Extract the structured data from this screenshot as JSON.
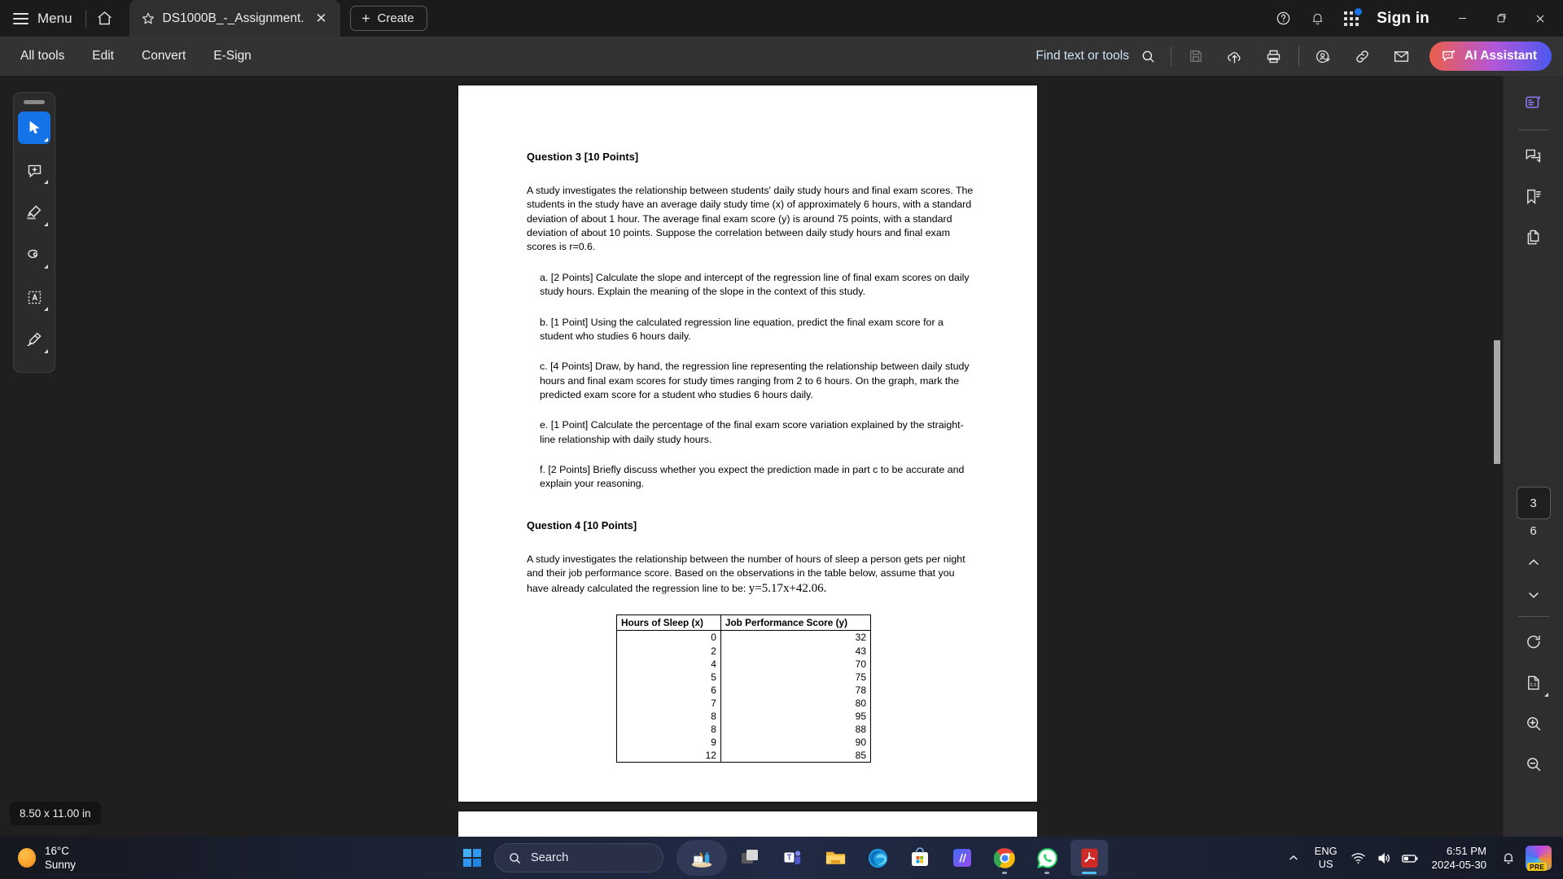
{
  "titlebar": {
    "menu_label": "Menu",
    "home_icon": "home-icon",
    "tab": {
      "star_icon": "star-icon",
      "title": "DS1000B_-_Assignment...",
      "close_icon": "close-icon"
    },
    "create_label": "Create",
    "help_icon": "help-circle-icon",
    "bell_icon": "bell-icon",
    "apps_icon": "apps-grid-icon",
    "signin_label": "Sign in",
    "minimize_icon": "minimize-icon",
    "maximize_icon": "maximize-icon",
    "close_icon": "window-close-icon"
  },
  "cmdbar": {
    "items": [
      {
        "label": "All tools",
        "name": "all-tools"
      },
      {
        "label": "Edit",
        "name": "edit"
      },
      {
        "label": "Convert",
        "name": "convert"
      },
      {
        "label": "E-Sign",
        "name": "esign"
      }
    ],
    "find_label": "Find text or tools",
    "icons": [
      "save-icon",
      "upload-cloud-icon",
      "print-icon",
      "add-person-icon",
      "link-icon",
      "email-icon"
    ],
    "ai_assistant_label": "AI Assistant",
    "ai_gradient_from": "#ec5f4a",
    "ai_gradient_to": "#4b58f0"
  },
  "left_toolbar": {
    "tools": [
      {
        "name": "select-tool",
        "icon": "cursor-icon",
        "active": true
      },
      {
        "name": "add-comment-tool",
        "icon": "comment-plus-icon",
        "active": false
      },
      {
        "name": "highlight-tool",
        "icon": "highlighter-icon",
        "active": false
      },
      {
        "name": "draw-oval-tool",
        "icon": "lasso-icon",
        "active": false
      },
      {
        "name": "text-select-tool",
        "icon": "text-box-icon",
        "active": false
      },
      {
        "name": "fill-sign-tool",
        "icon": "pen-sign-icon",
        "active": false
      }
    ]
  },
  "right_rail": {
    "tools": [
      {
        "name": "ai-summary",
        "icon": "ai-summary-icon",
        "accent": "#7a6ff0"
      },
      {
        "name": "comments",
        "icon": "comment-bubbles-icon"
      },
      {
        "name": "bookmarks",
        "icon": "bookmark-list-icon"
      },
      {
        "name": "page-thumbnails",
        "icon": "copy-pages-icon"
      }
    ],
    "current_page": "3",
    "total_pages": "6",
    "prev_icon": "chevron-up-icon",
    "next_icon": "chevron-down-icon",
    "rotate_icon": "rotate-icon",
    "fit_icon": "fit-page-icon",
    "zoom_in_icon": "zoom-in-icon",
    "zoom_out_icon": "zoom-out-icon"
  },
  "document": {
    "page_size_label": "8.50 x 11.00 in",
    "q3_title": "Question 3 [10 Points]",
    "q3_intro": "A study investigates the relationship between students' daily study hours and final exam scores. The students in the study have an average daily study time (x) of approximately 6 hours, with a standard deviation of about 1 hour. The average final exam score (y) is around 75 points, with a standard deviation of about 10 points. Suppose the correlation between daily study hours and final exam scores is r=0.6.",
    "q3_parts": [
      "a. [2 Points] Calculate the slope and intercept of the regression line of final exam scores on daily study hours. Explain the meaning of the slope in the context of this study.",
      "b. [1 Point] Using the calculated regression line equation, predict the final exam score for a student who studies 6 hours daily.",
      "c. [4 Points] Draw, by hand, the regression line representing the relationship between daily study hours and final exam scores for study times ranging from 2 to 6 hours. On the graph, mark the predicted exam score for a student who studies 6 hours daily.",
      "e. [1 Point] Calculate the percentage of the final exam score variation explained by the straight-line relationship with daily study hours.",
      "f. [2 Points] Briefly discuss whether you expect the prediction made in part c to be accurate and explain your reasoning."
    ],
    "q4_title": "Question 4 [10 Points]",
    "q4_intro_pre": "A study investigates the relationship between the number of hours of sleep a person gets per night and their job performance score. Based on the observations in the table below, assume that you have already calculated the regression line to be: ",
    "q4_equation": "y=5.17x+42.06.",
    "table": {
      "headers": [
        "Hours of Sleep (x)",
        "Job Performance Score (y)"
      ],
      "rows": [
        [
          "0",
          "32"
        ],
        [
          "2",
          "43"
        ],
        [
          "4",
          "70"
        ],
        [
          "5",
          "75"
        ],
        [
          "6",
          "78"
        ],
        [
          "7",
          "80"
        ],
        [
          "8",
          "95"
        ],
        [
          "8",
          "88"
        ],
        [
          "9",
          "90"
        ],
        [
          "12",
          "85"
        ]
      ]
    }
  },
  "taskbar": {
    "weather_temp": "16°C",
    "weather_cond": "Sunny",
    "start_icon": "windows-start-icon",
    "search_placeholder": "Search",
    "apps": [
      {
        "name": "copilot-study-app",
        "icon": "study-desk-icon"
      },
      {
        "name": "task-view",
        "icon": "task-view-icon"
      },
      {
        "name": "microsoft-teams",
        "icon": "teams-icon"
      },
      {
        "name": "file-explorer",
        "icon": "folder-icon"
      },
      {
        "name": "microsoft-edge",
        "icon": "edge-icon"
      },
      {
        "name": "microsoft-store",
        "icon": "store-icon"
      },
      {
        "name": "mega-app",
        "icon": "m-app-icon"
      },
      {
        "name": "google-chrome",
        "icon": "chrome-icon"
      },
      {
        "name": "whatsapp",
        "icon": "whatsapp-icon"
      },
      {
        "name": "adobe-acrobat",
        "icon": "acrobat-icon"
      }
    ],
    "tray": {
      "overflow_icon": "chevron-up-icon",
      "lang_line1": "ENG",
      "lang_line2": "US",
      "wifi_icon": "wifi-icon",
      "volume_icon": "volume-icon",
      "battery_icon": "battery-icon",
      "time": "6:51 PM",
      "date": "2024-05-30",
      "notification_icon": "bell-icon",
      "copilot_icon": "copilot-icon",
      "copilot_badge": "PRE"
    }
  }
}
